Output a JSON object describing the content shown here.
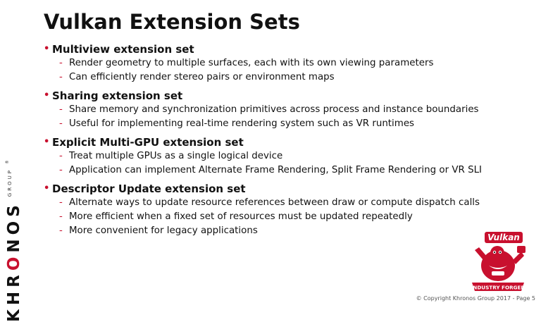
{
  "slide": {
    "title": "Vulkan Extension Sets",
    "sections": [
      {
        "heading": "Multiview extension set",
        "items": [
          "Render geometry to multiple surfaces, each with its own viewing parameters",
          "Can efficiently render stereo pairs or environment maps"
        ]
      },
      {
        "heading": "Sharing extension set",
        "items": [
          "Share memory and synchronization primitives across process and instance boundaries",
          "Useful for implementing real-time rendering system such as VR runtimes"
        ]
      },
      {
        "heading": "Explicit Multi-GPU extension set",
        "items": [
          "Treat multiple GPUs as a single logical device",
          "Application can implement Alternate Frame Rendering, Split Frame Rendering or VR SLI"
        ]
      },
      {
        "heading": "Descriptor Update extension set",
        "items": [
          "Alternate ways to update resource references between draw or compute dispatch calls",
          "More efficient when a fixed set of resources must be updated repeatedly",
          "More convenient for legacy applications"
        ]
      }
    ],
    "bullet_glyph": "•",
    "dash_glyph": "-"
  },
  "brand": {
    "khronos_prefix": "KHR",
    "khronos_o": "O",
    "khronos_suffix": "NOS",
    "group": "GROUP",
    "trademark": "®",
    "accent_color": "#c8102e"
  },
  "vulkan_logo": {
    "word": "Vulkan",
    "banner": "INDUSTRY FORGED",
    "icon": "vulkan-logo-icon"
  },
  "footer": {
    "copyright": "© Copyright Khronos Group 2017 - Page 5"
  }
}
